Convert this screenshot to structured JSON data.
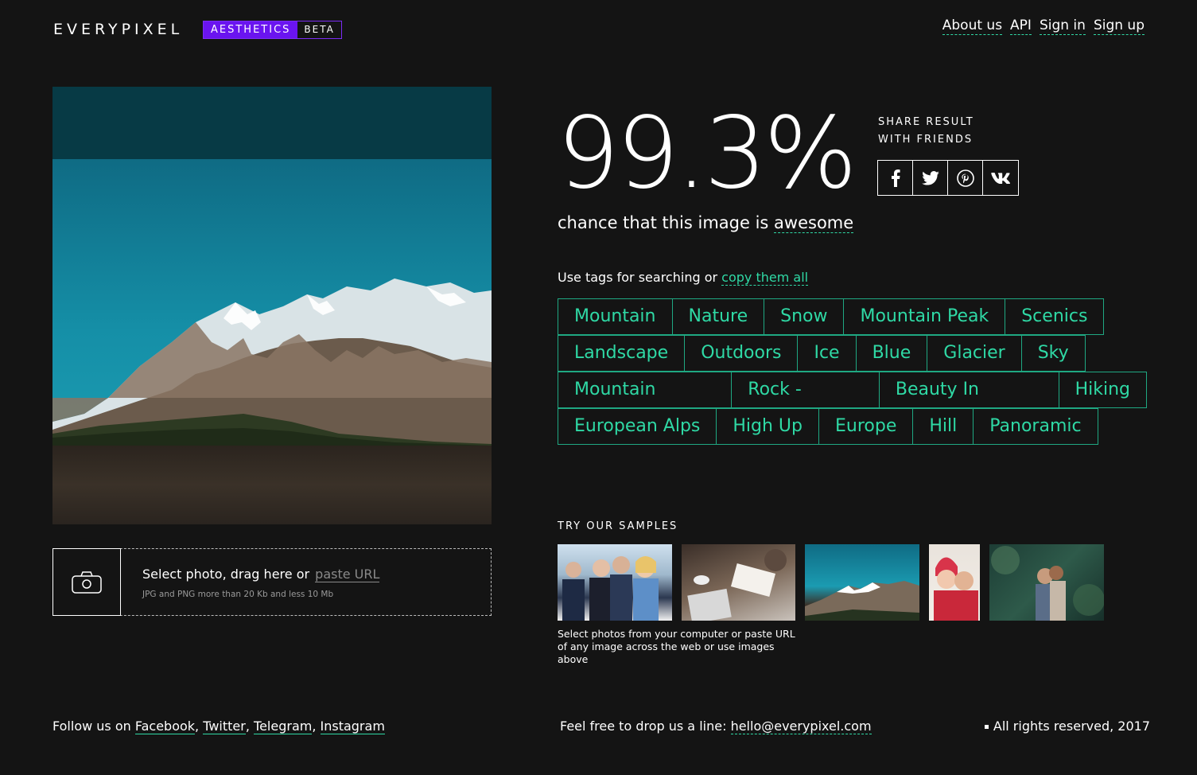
{
  "header": {
    "logo": "EVERYPIXEL",
    "badge_primary": "AESTHETICS",
    "badge_secondary": "BETA",
    "nav": [
      "About us",
      "API",
      "Sign in",
      "Sign up"
    ]
  },
  "result": {
    "score": "99.3%",
    "chance_prefix": "chance that this image is",
    "chance_word": "awesome",
    "share_line1": "SHARE RESULT",
    "share_line2": "WITH FRIENDS",
    "share_icons": [
      "facebook-icon",
      "twitter-icon",
      "pinterest-icon",
      "vk-icon"
    ]
  },
  "tags": {
    "hint_prefix": "Use tags for searching or",
    "hint_link": "copy them all",
    "rows": [
      [
        "Mountain",
        "Nature",
        "Snow",
        "Mountain Peak",
        "Scenics"
      ],
      [
        "Landscape",
        "Outdoors",
        "Ice",
        "Blue",
        "Glacier",
        "Sky"
      ],
      [
        "Mountain Range",
        "Rock - Object",
        "Beauty In Nature",
        "Hiking"
      ],
      [
        "European Alps",
        "High Up",
        "Europe",
        "Hill",
        "Panoramic"
      ]
    ]
  },
  "upload": {
    "main_text": "Select photo, drag here or",
    "url_link": "paste URL",
    "sub_text": "JPG and PNG more than 20 Kb and less 10 Mb"
  },
  "samples": {
    "label": "TRY OUR SAMPLES",
    "caption_line1": "Select photos from your computer or paste URL",
    "caption_line2": "of any image across the web or use images above"
  },
  "footer": {
    "follow_prefix": "Follow us on",
    "links": [
      "Facebook",
      "Twitter",
      "Telegram",
      "Instagram"
    ],
    "contact_prefix": "Feel free to drop us a line:",
    "email": "hello@everypixel.com",
    "rights": "All rights reserved, 2017"
  },
  "colors": {
    "background": "#141414",
    "accent": "#2fd9a5",
    "badge": "#6a14f0"
  }
}
